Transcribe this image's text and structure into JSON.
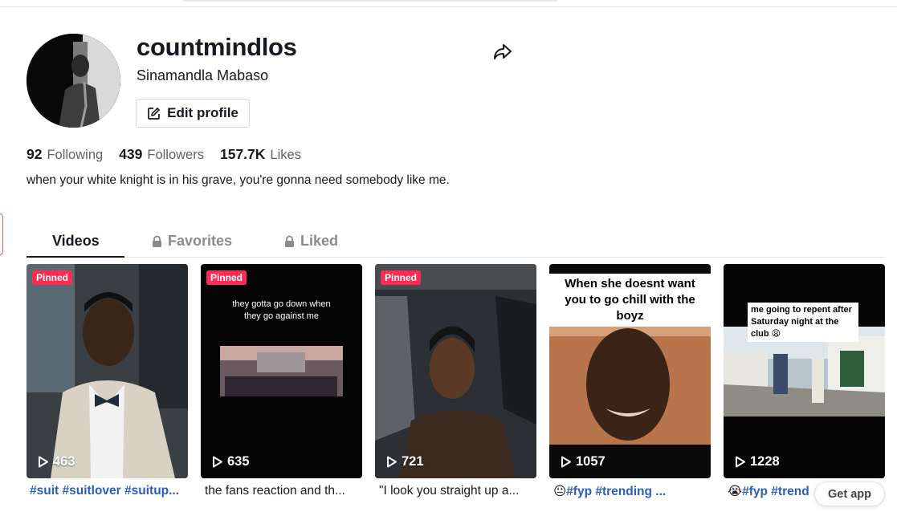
{
  "profile": {
    "username": "countmindlos",
    "nickname": "Sinamandla Mabaso",
    "edit_label": "Edit profile",
    "bio": "when your white knight is in his grave, you're gonna need somebody like me."
  },
  "stats": {
    "following_count": "92",
    "following_label": "Following",
    "followers_count": "439",
    "followers_label": "Followers",
    "likes_count": "157.7K",
    "likes_label": "Likes"
  },
  "tabs": {
    "videos": "Videos",
    "favorites": "Favorites",
    "liked": "Liked"
  },
  "videos": [
    {
      "pinned": "Pinned",
      "views": "463",
      "caption_tags": "#suit #suitlover #suitup...",
      "caption_text": ""
    },
    {
      "pinned": "Pinned",
      "views": "635",
      "overlay": "they gotta go down when they go against me",
      "caption_text": "the fans reaction and th..."
    },
    {
      "pinned": "Pinned",
      "views": "721",
      "caption_text": "\"I look you straight up a..."
    },
    {
      "views": "1057",
      "overlay": "When she doesnt want you to go chill with the boyz",
      "caption_emoji": "😐",
      "caption_tags": "#fyp #trending ..."
    },
    {
      "views": "1228",
      "overlay": "me going to repent after Saturday night at the club 😩",
      "caption_emoji": "😭",
      "caption_tags": "#fyp #trend"
    }
  ],
  "get_app": "Get app",
  "colors": {
    "pinned_badge": "#fe2c55",
    "hashtag": "#2b5db9",
    "muted_text": "#8a8b91"
  }
}
